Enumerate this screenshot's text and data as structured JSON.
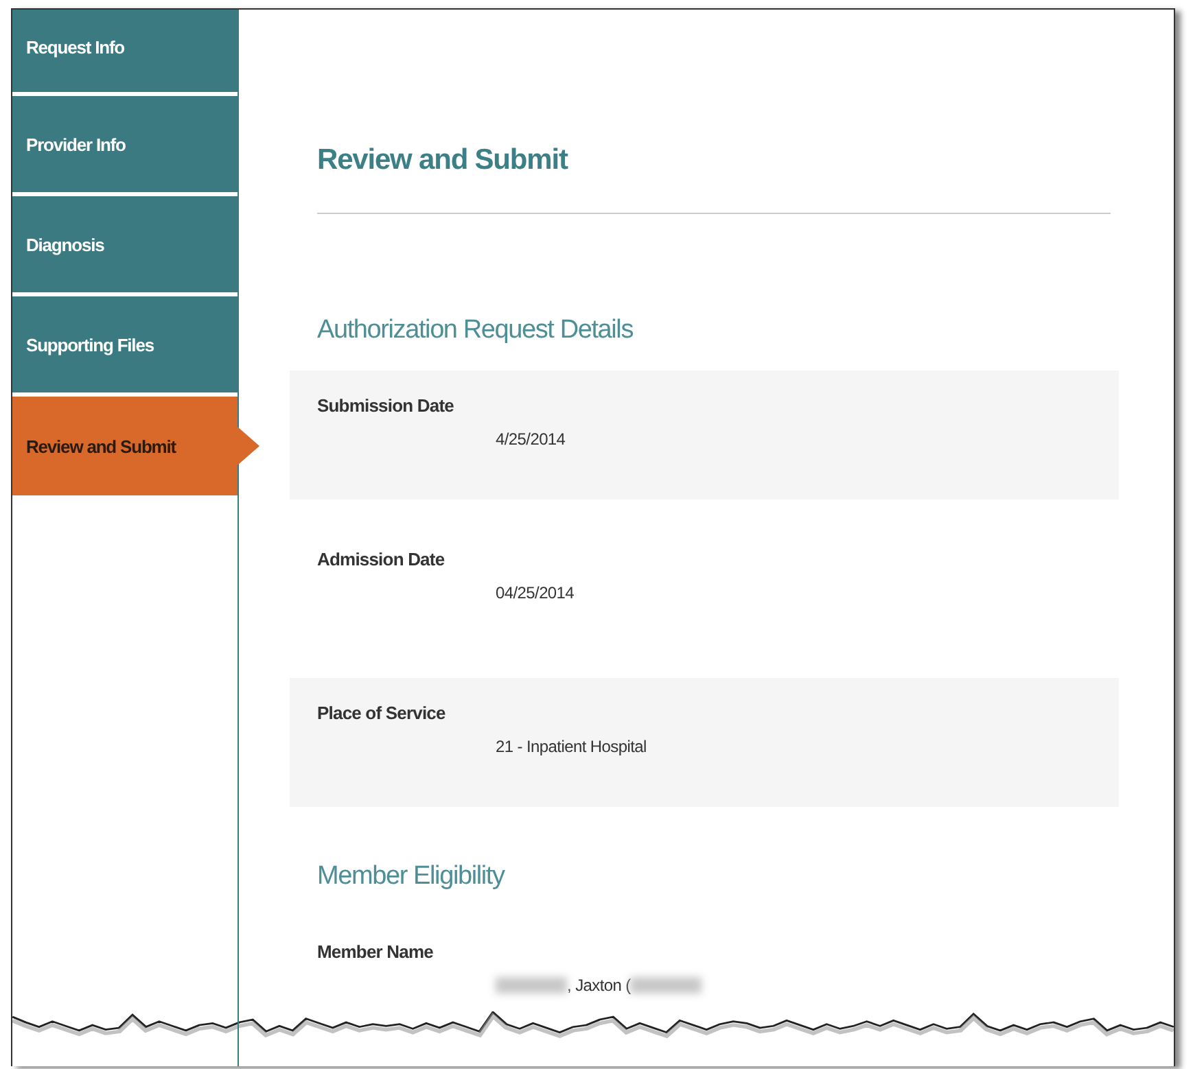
{
  "sidebar": {
    "items": [
      {
        "label": "Request Info",
        "selected": false
      },
      {
        "label": "Provider Info",
        "selected": false
      },
      {
        "label": "Diagnosis",
        "selected": false
      },
      {
        "label": "Supporting Files",
        "selected": false
      },
      {
        "label": "Review and Submit",
        "selected": true
      }
    ]
  },
  "page": {
    "title": "Review and Submit"
  },
  "sections": [
    {
      "title": "Authorization Request Details",
      "fields": [
        {
          "label": "Submission Date",
          "value": "4/25/2014"
        },
        {
          "label": "Admission Date",
          "value": "04/25/2014"
        },
        {
          "label": "Place of Service",
          "value": "21 - Inpatient Hospital"
        }
      ]
    },
    {
      "title": "Member Eligibility",
      "fields": [
        {
          "label": "Member Name",
          "value": ", Jaxton (",
          "redacted": true
        }
      ]
    }
  ]
}
